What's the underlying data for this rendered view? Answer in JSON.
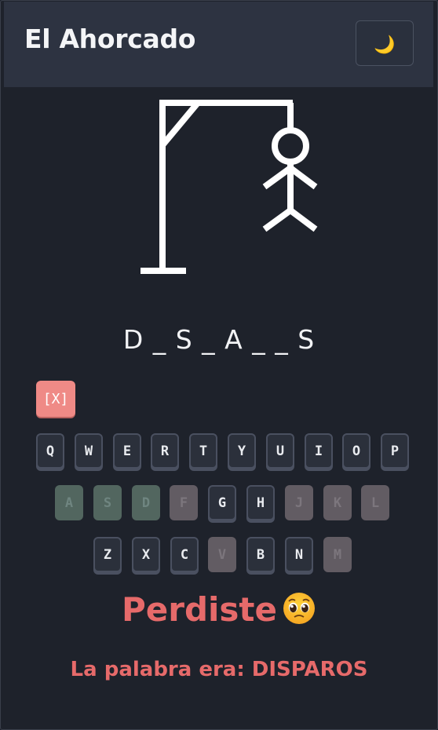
{
  "header": {
    "title": "El Ahorcado",
    "theme_icon": "moon-icon",
    "theme_glyph": "🌙"
  },
  "game": {
    "word_display": "D _ S _ A _ _ S",
    "wrong_guesses": 6,
    "max_wrong": 6
  },
  "keyboard": {
    "close_label": "[X]",
    "rows": [
      [
        {
          "letter": "Q",
          "state": "available"
        },
        {
          "letter": "W",
          "state": "available"
        },
        {
          "letter": "E",
          "state": "available"
        },
        {
          "letter": "R",
          "state": "available"
        },
        {
          "letter": "T",
          "state": "available"
        },
        {
          "letter": "Y",
          "state": "available"
        },
        {
          "letter": "U",
          "state": "available"
        },
        {
          "letter": "I",
          "state": "available"
        },
        {
          "letter": "O",
          "state": "available"
        },
        {
          "letter": "P",
          "state": "available"
        }
      ],
      [
        {
          "letter": "A",
          "state": "correct"
        },
        {
          "letter": "S",
          "state": "correct"
        },
        {
          "letter": "D",
          "state": "correct"
        },
        {
          "letter": "F",
          "state": "wrong"
        },
        {
          "letter": "G",
          "state": "available"
        },
        {
          "letter": "H",
          "state": "available"
        },
        {
          "letter": "J",
          "state": "wrong"
        },
        {
          "letter": "K",
          "state": "wrong"
        },
        {
          "letter": "L",
          "state": "wrong"
        }
      ],
      [
        {
          "letter": "Z",
          "state": "available"
        },
        {
          "letter": "X",
          "state": "available"
        },
        {
          "letter": "C",
          "state": "available"
        },
        {
          "letter": "V",
          "state": "wrong"
        },
        {
          "letter": "B",
          "state": "available"
        },
        {
          "letter": "N",
          "state": "available"
        },
        {
          "letter": "M",
          "state": "wrong"
        }
      ]
    ]
  },
  "result": {
    "message": "Perdiste",
    "emoji_icon": "pleading-face-icon",
    "reveal_text": "La palabra era: DISPAROS"
  },
  "colors": {
    "background": "#1e222b",
    "header": "#2d3341",
    "lose_text": "#e66a6a",
    "close_key": "#ef8a86",
    "correct_key": "#52665f",
    "wrong_key": "#625c63"
  }
}
